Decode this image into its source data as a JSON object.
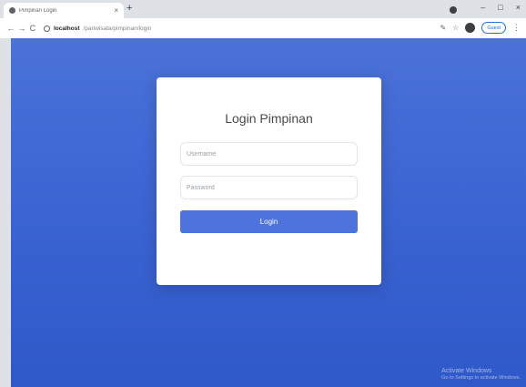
{
  "browser": {
    "tab_title": "Pimpinan Login",
    "tab_close": "×",
    "new_tab": "+",
    "url_host": "localhost",
    "url_path": "/pariwisata/pimpinan/login",
    "signin_label": "Guest",
    "minimize": "–",
    "maximize": "□",
    "close": "×",
    "back": "←",
    "forward": "→",
    "reload": "C"
  },
  "login": {
    "title": "Login Pimpinan",
    "username_placeholder": "Username",
    "password_placeholder": "Password",
    "button_label": "Login"
  },
  "watermark": {
    "line1": "Activate Windows",
    "line2": "Go to Settings to activate Windows."
  },
  "colors": {
    "accent": "#4e73dc",
    "background": "#3a63d2"
  }
}
